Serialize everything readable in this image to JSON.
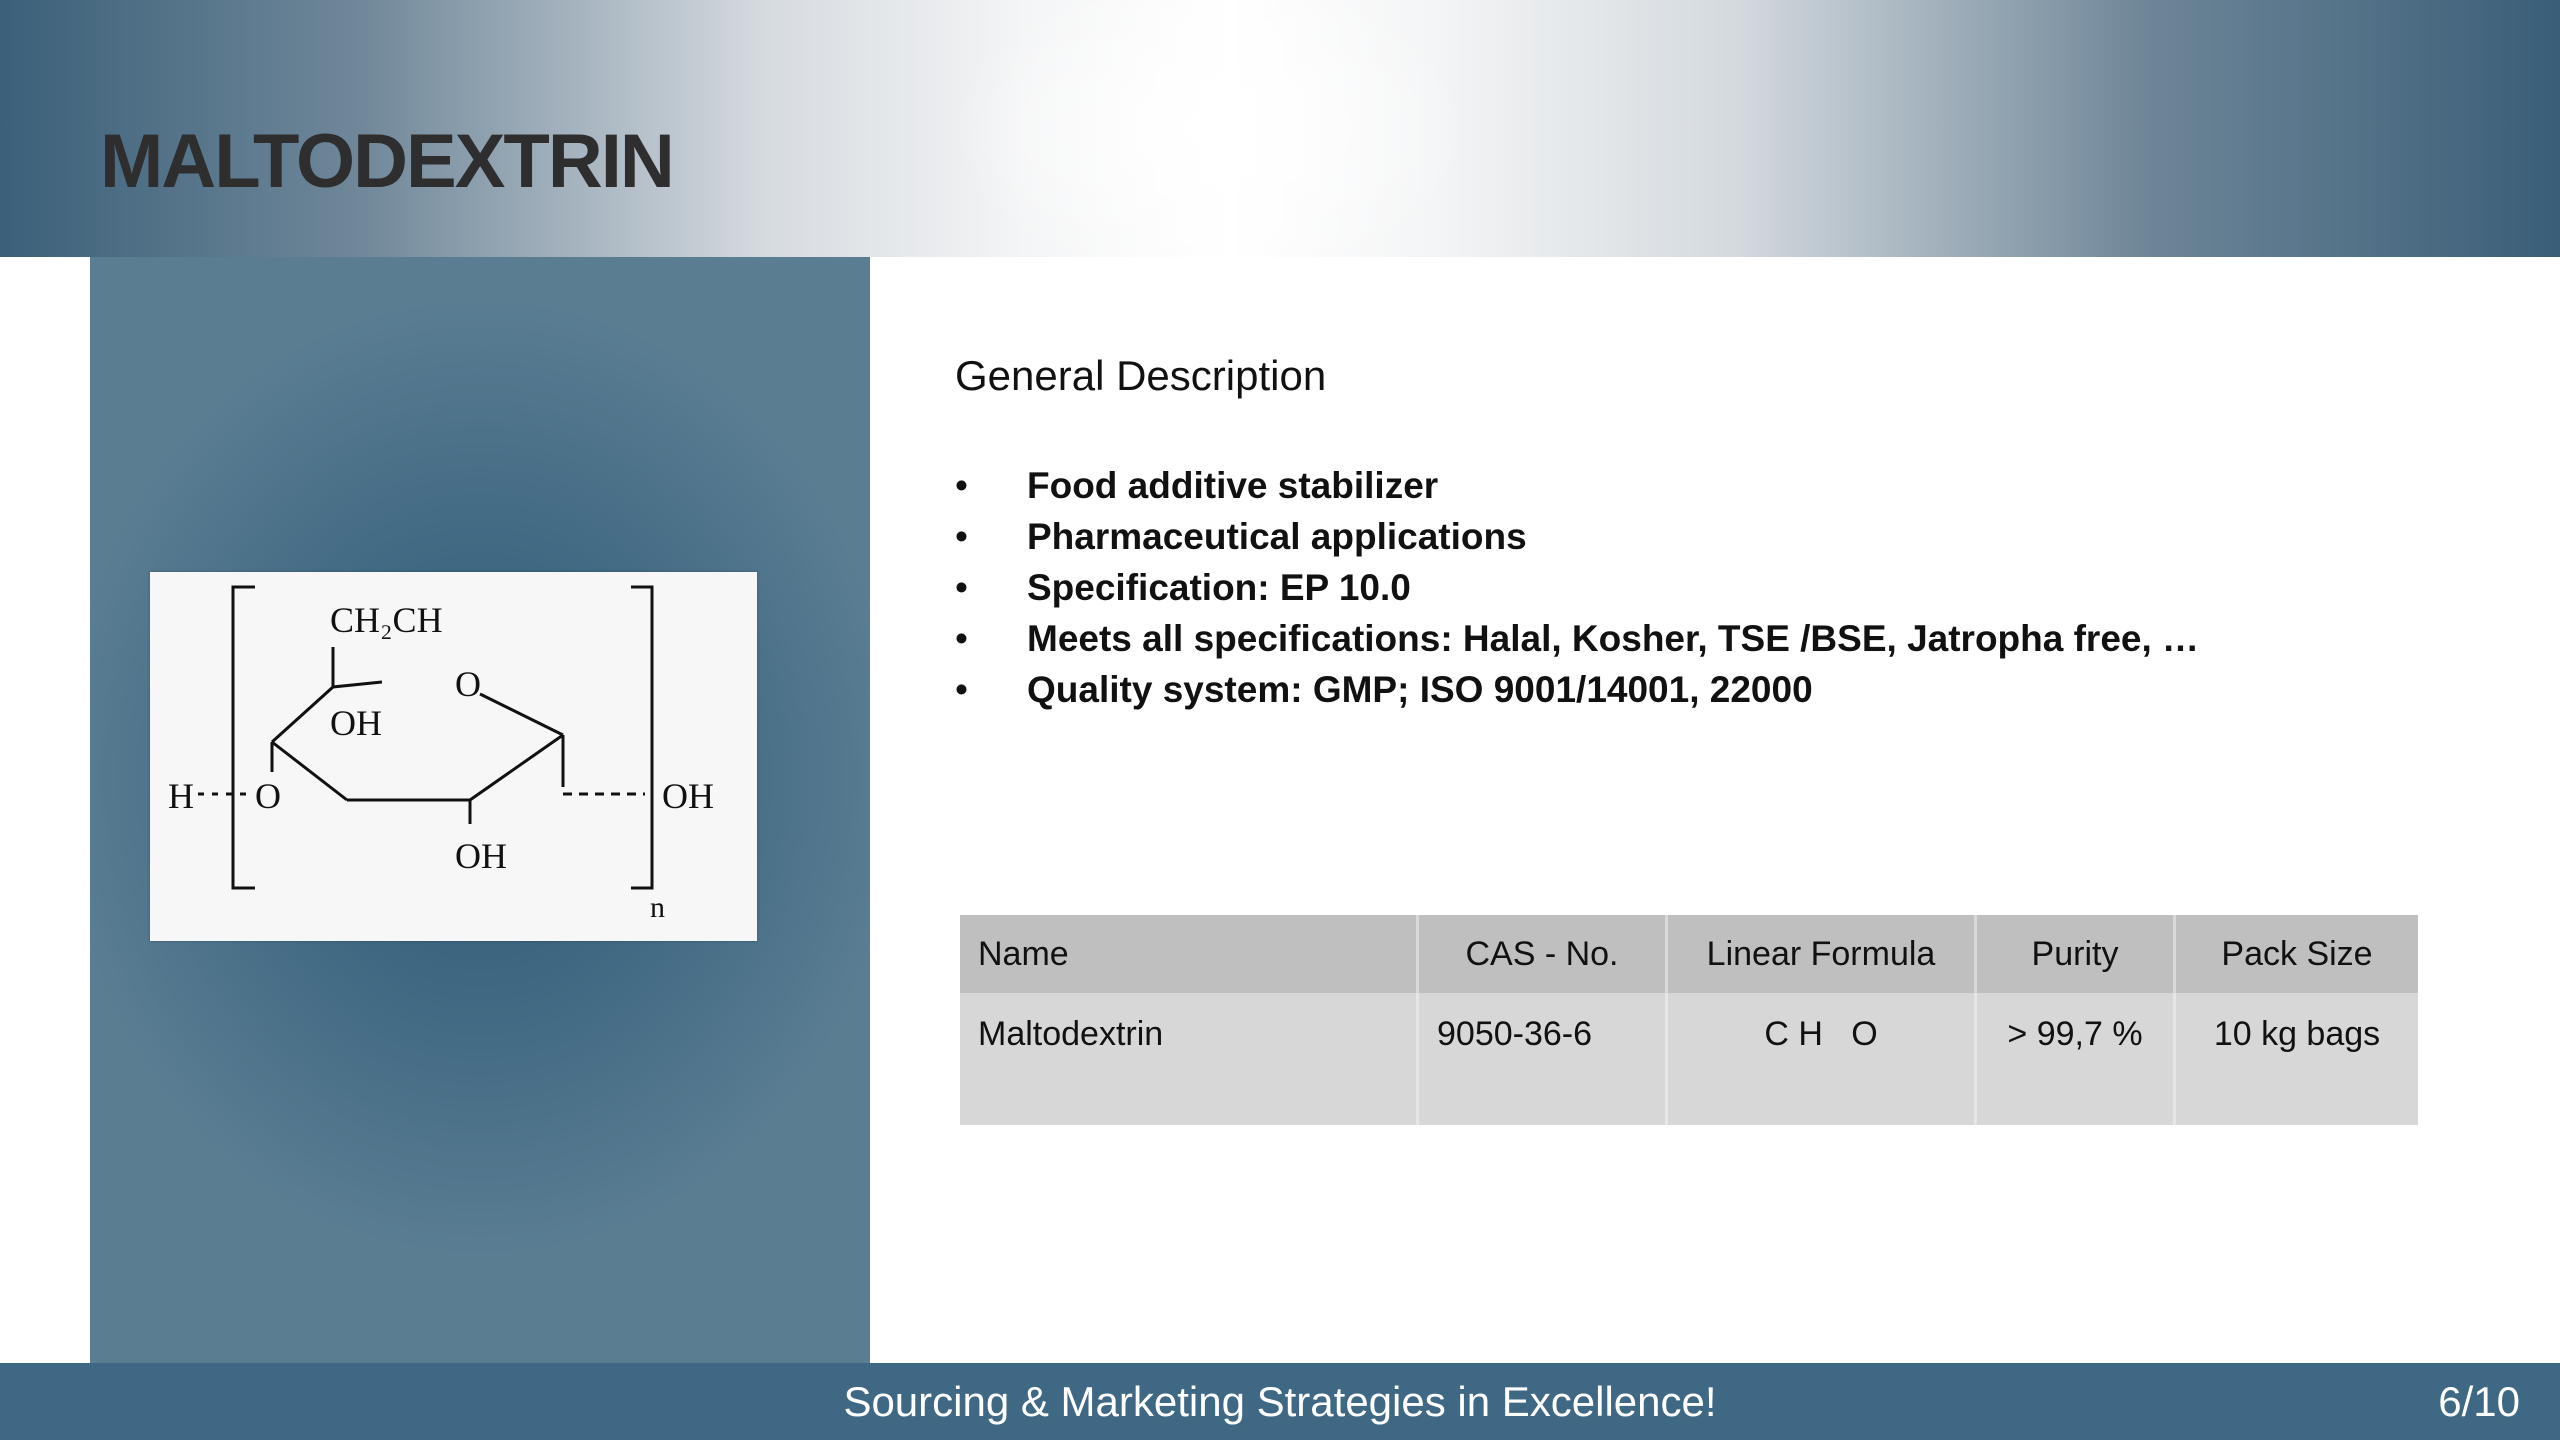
{
  "header": {
    "title": "MALTODEXTRIN"
  },
  "structure": {
    "labels": {
      "ch2ch": "CH₂CH",
      "ring_o": "O",
      "oh_top": "OH",
      "h": "H",
      "o_left": "O",
      "oh_right": "OH",
      "oh_bottom": "OH",
      "n": "n"
    }
  },
  "description": {
    "heading": "General Description",
    "bullet_glyph": "•",
    "items": [
      "Food additive stabilizer",
      "Pharmaceutical applications",
      "Specification: EP 10.0",
      "Meets all specifications:  Halal, Kosher, TSE /BSE, Jatropha free, …",
      "Quality system: GMP; ISO 9001/14001, 22000"
    ]
  },
  "table": {
    "headers": [
      "Name",
      "CAS - No.",
      "Linear Formula",
      "Purity",
      "Pack Size"
    ],
    "rows": [
      [
        "Maltodextrin",
        "9050-36-6",
        "C H   O",
        "> 99,7 %",
        "10 kg bags"
      ]
    ]
  },
  "footer": {
    "tagline": "Sourcing & Marketing Strategies in Excellence!",
    "page": "6/10"
  },
  "colors": {
    "brand_blue": "#3f6884",
    "table_header": "#bfbfbf",
    "table_row": "#d7d7d7"
  }
}
